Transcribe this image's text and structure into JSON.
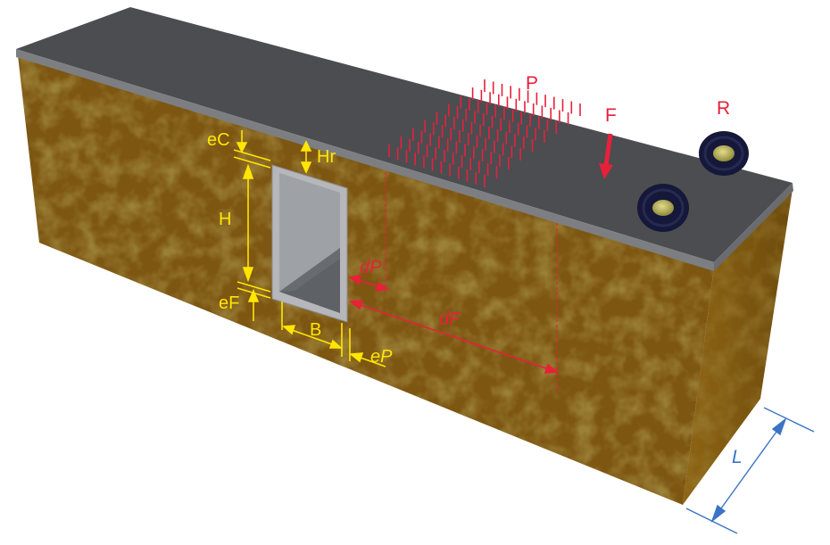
{
  "labels": {
    "eC": "eC",
    "Hr": "Hr",
    "H": "H",
    "eF": "eF",
    "B": "B",
    "eP": "eP",
    "dP": "dP",
    "dF": "dF",
    "P": "P",
    "F": "F",
    "R": "R",
    "L": "L"
  },
  "colors": {
    "dimension_yellow": "#ffe600",
    "load_red": "#e8203a",
    "length_blue": "#3a74c4",
    "soil": "#7a5410",
    "road": "#4a4c50"
  }
}
